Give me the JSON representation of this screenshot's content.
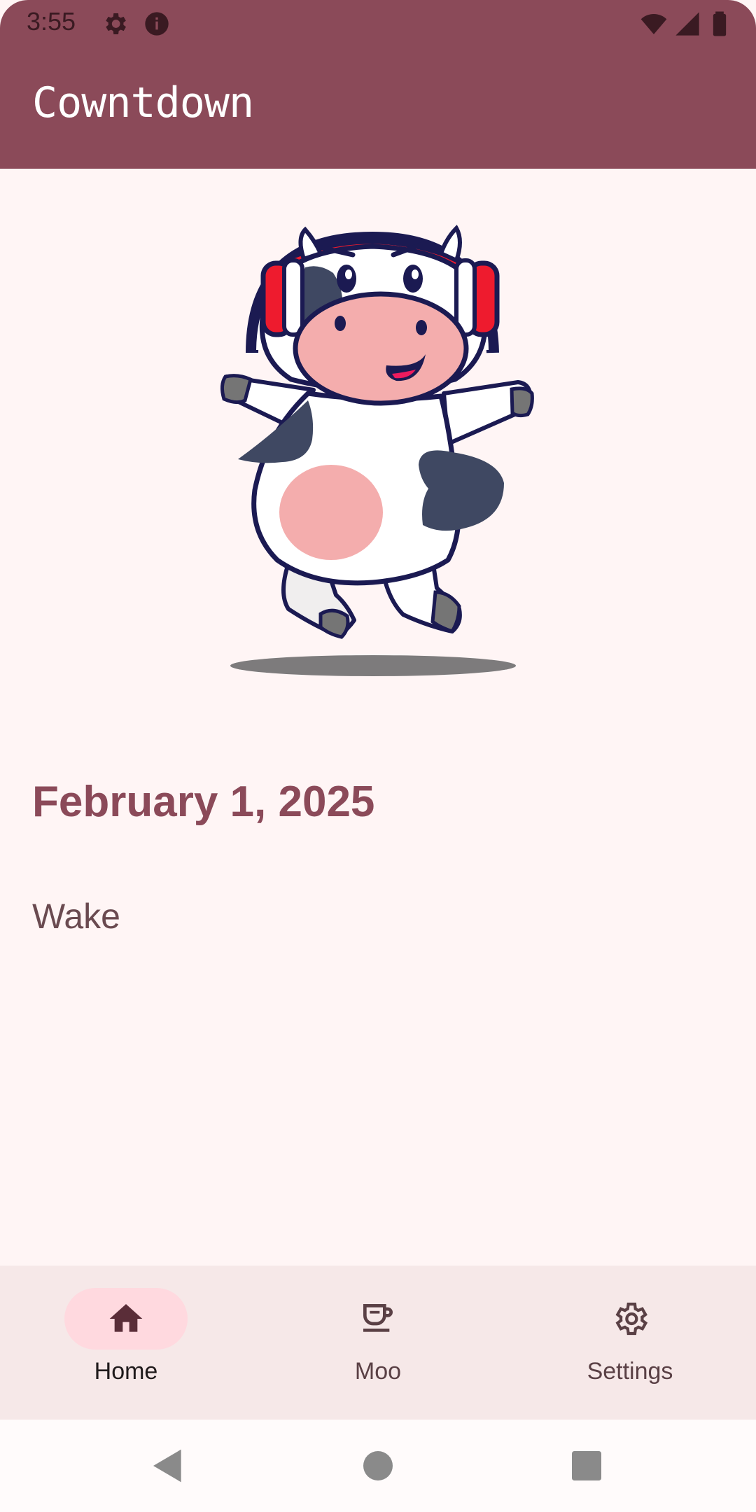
{
  "status_bar": {
    "time": "3:55",
    "left_icons": [
      "settings-icon",
      "info-icon"
    ],
    "right_icons": [
      "wifi-icon",
      "signal-icon",
      "battery-icon"
    ]
  },
  "app_bar": {
    "title": "Cowntdown"
  },
  "colors": {
    "app_bar": "#8b4a59",
    "background": "#fff5f5",
    "date_text": "#8b4a59",
    "nav_background": "#f6e8e8",
    "nav_active_pill": "#ffd9df"
  },
  "main": {
    "illustration": "dancing-cow-with-headphones",
    "date": "February 1, 2025",
    "event": "Wake"
  },
  "bottom_nav": {
    "items": [
      {
        "label": "Home",
        "icon": "home-icon",
        "active": true
      },
      {
        "label": "Moo",
        "icon": "cup-icon",
        "active": false
      },
      {
        "label": "Settings",
        "icon": "settings-icon",
        "active": false
      }
    ]
  },
  "system_nav": [
    "back-icon",
    "home-circle-icon",
    "recents-icon"
  ]
}
